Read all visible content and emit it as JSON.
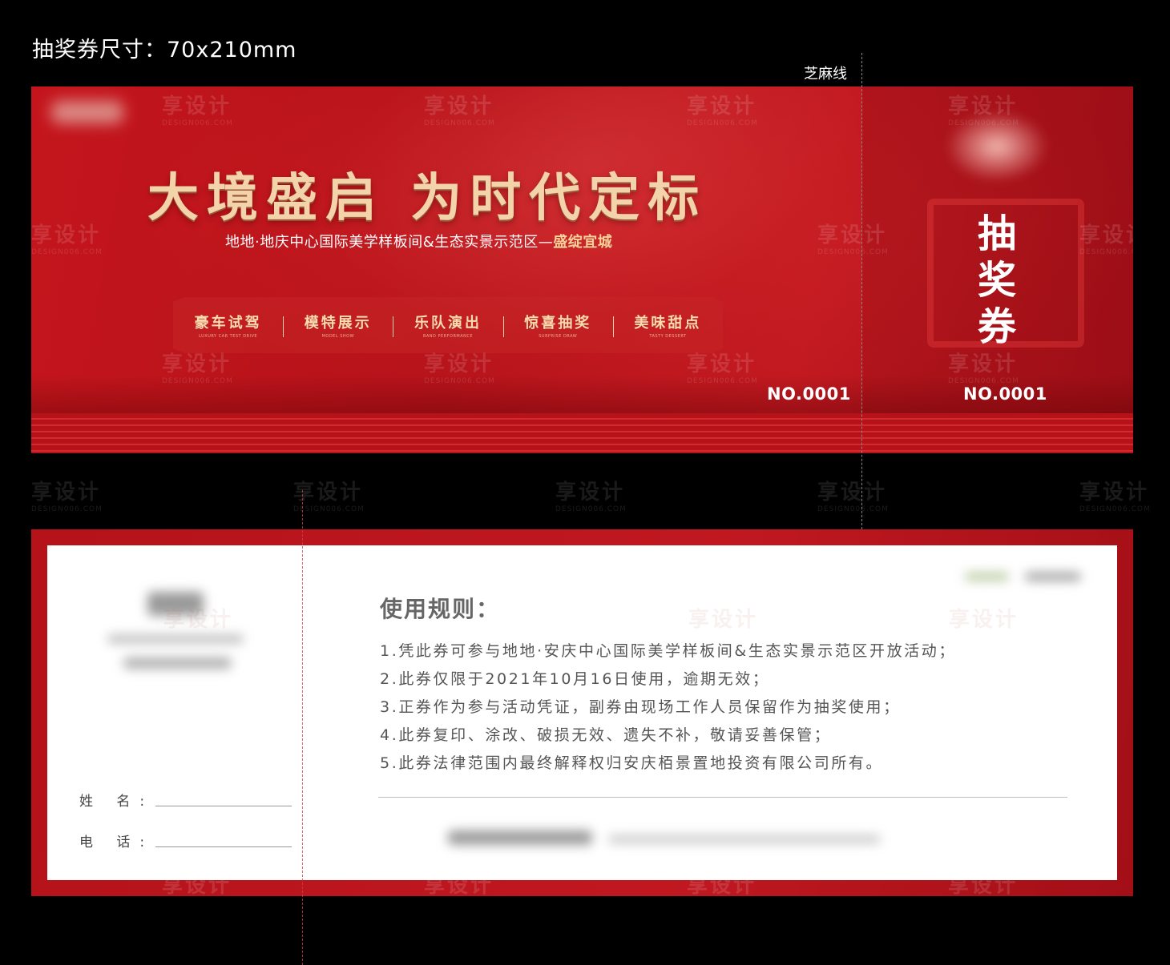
{
  "spec_label": "抽奖券尺寸：70x210mm",
  "perforation_label": "芝麻线",
  "front": {
    "headline": "大境盛启  为时代定标",
    "subline_main": "地地·地庆中心国际美学样板间&生态实景示范区—",
    "subline_accent": "盛绽宜城",
    "features": [
      {
        "cn": "豪车试驾",
        "en": "LUXURY CAR TEST DRIVE"
      },
      {
        "cn": "模特展示",
        "en": "MODEL SHOW"
      },
      {
        "cn": "乐队演出",
        "en": "BAND PERFORMANCE"
      },
      {
        "cn": "惊喜抽奖",
        "en": "SURPRISE DRAW"
      },
      {
        "cn": "美味甜点",
        "en": "TASTY DESSERT"
      }
    ],
    "serial_main": "NO.0001",
    "stub_title": [
      "抽",
      "奖",
      "券"
    ],
    "serial_stub": "NO.0001"
  },
  "watermark": {
    "cn": "享设计",
    "en": "DESIGN006.COM"
  },
  "back": {
    "name_label": "姓  名:",
    "phone_label": "电  话:",
    "rules_title": "使用规则：",
    "rules": [
      "1.凭此券可参与地地·安庆中心国际美学样板间&生态实景示范区开放活动；",
      "2.此券仅限于2021年10月16日使用，逾期无效；",
      "3.正券作为参与活动凭证，副券由现场工作人员保留作为抽奖使用；",
      "4.此券复印、涂改、破损无效、遗失不补，敬请妥善保管；",
      "5.此券法律范围内最终解释权归安庆栢景置地投资有限公司所有。"
    ]
  },
  "colors": {
    "ticket_red": "#c4151c",
    "gold": "#f3d3a9",
    "back_card": "#ffffff"
  }
}
